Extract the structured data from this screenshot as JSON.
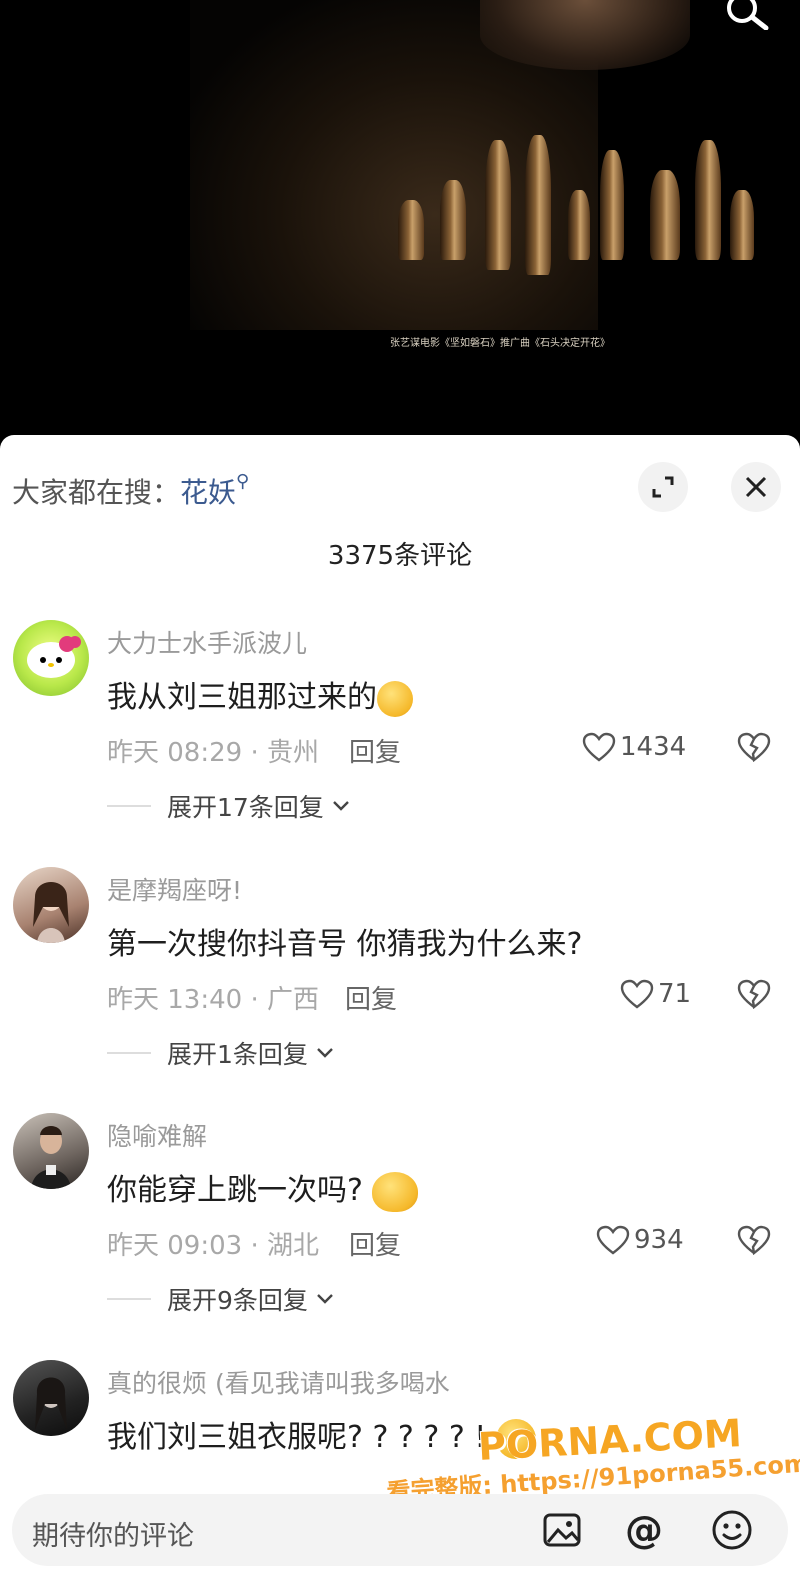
{
  "video": {
    "caption": "张艺谋电影《坚如磐石》推广曲《石头决定开花》"
  },
  "sheet": {
    "hot_search_prefix": "大家都在搜：",
    "hot_search_keyword": "花妖",
    "comment_count": "3375条评论"
  },
  "comments": [
    {
      "username": "大力士水手派波儿",
      "text": "我从刘三姐那过来的",
      "emoji": "crying-laughing-emoji",
      "meta": "昨天 08:29 · 贵州",
      "reply": "回复",
      "likes": "1434",
      "expand": "展开17条回复"
    },
    {
      "username": "是摩羯座呀!",
      "text": "第一次搜你抖音号 你猜我为什么来?",
      "meta": "昨天 13:40 · 广西",
      "reply": "回复",
      "likes": "71",
      "expand": "展开1条回复"
    },
    {
      "username": "隐喻难解",
      "text": "你能穿上跳一次吗?",
      "emoji": "shy-emoji",
      "meta": "昨天 09:03 · 湖北",
      "reply": "回复",
      "likes": "934",
      "expand": "展开9条回复"
    },
    {
      "username": "真的很烦 (看见我请叫我多喝水",
      "text": "我们刘三姐衣服呢? ? ? ? ? !",
      "emoji": "smile-emoji"
    }
  ],
  "input": {
    "placeholder": "期待你的评论"
  },
  "watermark": {
    "brand": "PORNA.COM",
    "url": "看完整版: https://91porna55.com"
  },
  "colors": {
    "keyword": "#3b5a8f",
    "watermark": "#f6a623"
  }
}
